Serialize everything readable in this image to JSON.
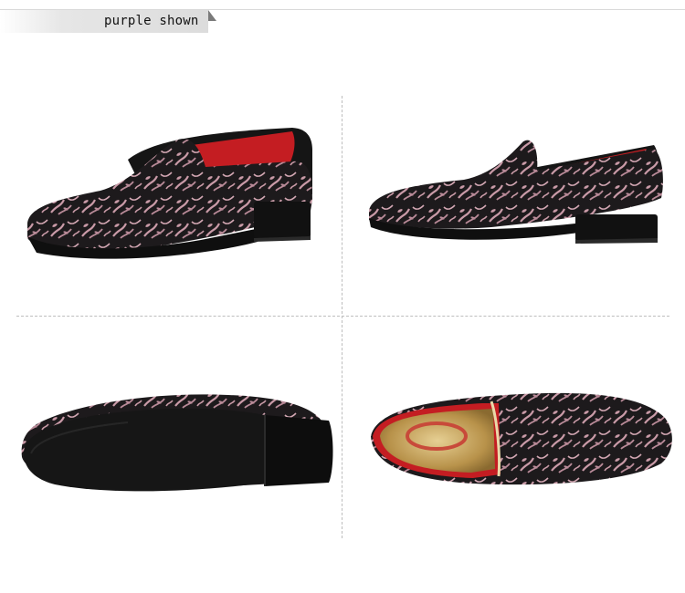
{
  "header": {
    "caption": "purple shown"
  },
  "colors": {
    "fabric_dark": "#1d1a1c",
    "pattern_pink": "#c99aa7",
    "lining_red": "#c41d22",
    "insole_gold": "#c9a65c",
    "sole_black": "#151515"
  },
  "gallery": {
    "views": [
      "side-view-left",
      "side-view-right",
      "sole-view",
      "top-interior-view"
    ]
  }
}
